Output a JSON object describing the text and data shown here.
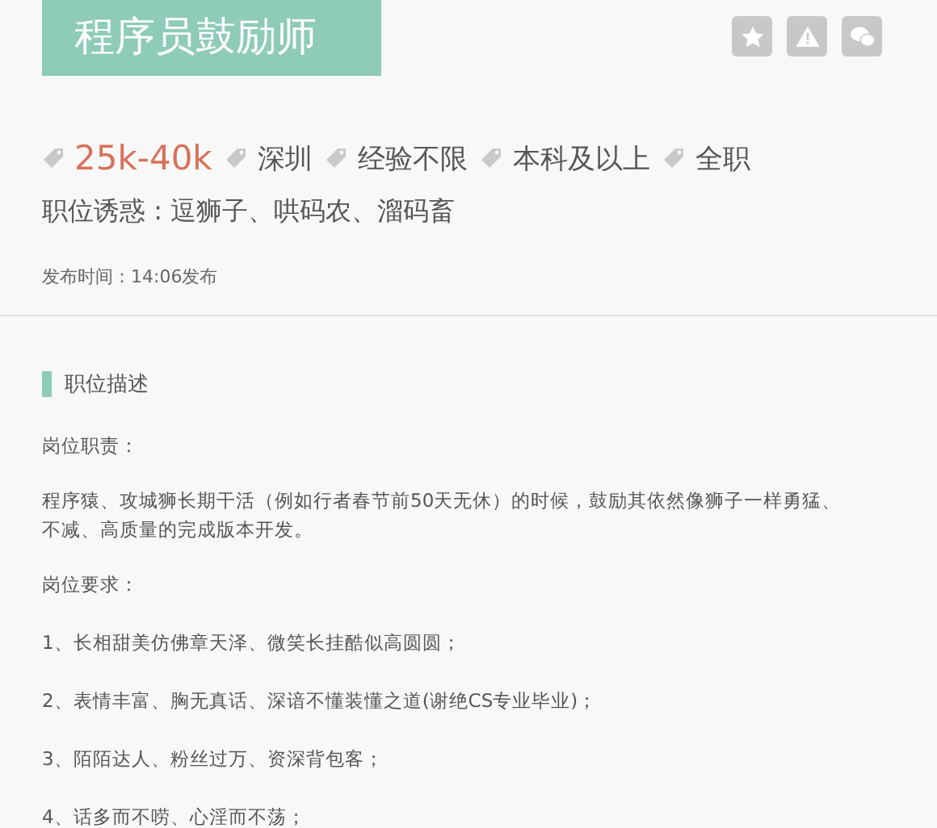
{
  "title": "程序员鼓励师",
  "actions": [
    {
      "kind": "star"
    },
    {
      "kind": "warning"
    },
    {
      "kind": "wechat"
    }
  ],
  "tags": [
    {
      "text": "25k-40k",
      "kind": "salary"
    },
    {
      "text": "深圳",
      "kind": "plain"
    },
    {
      "text": "经验不限",
      "kind": "plain"
    },
    {
      "text": "本科及以上",
      "kind": "plain"
    },
    {
      "text": "全职",
      "kind": "plain"
    }
  ],
  "perks": "职位诱惑 : 逗狮子、哄码农、溜码畜",
  "published": "发布时间：14:06发布",
  "section_title": "职位描述",
  "duties": {
    "heading": "岗位职责：",
    "lines": [
      "程序猿、攻城狮长期干活（例如行者春节前50天无休）的时候，鼓励其依然像狮子一样勇猛、",
      "不减、高质量的完成版本开发。"
    ]
  },
  "requirements": {
    "heading": "岗位要求：",
    "items": [
      "1、长相甜美仿佛章天泽、微笑长挂酷似高圆圆；",
      "2、表情丰富、胸无真话、深谙不懂装懂之道(谢绝CS专业毕业)；",
      "3、陌陌达人、粉丝过万、资深背包客；",
      "4、话多而不唠、心淫而不荡；"
    ]
  }
}
